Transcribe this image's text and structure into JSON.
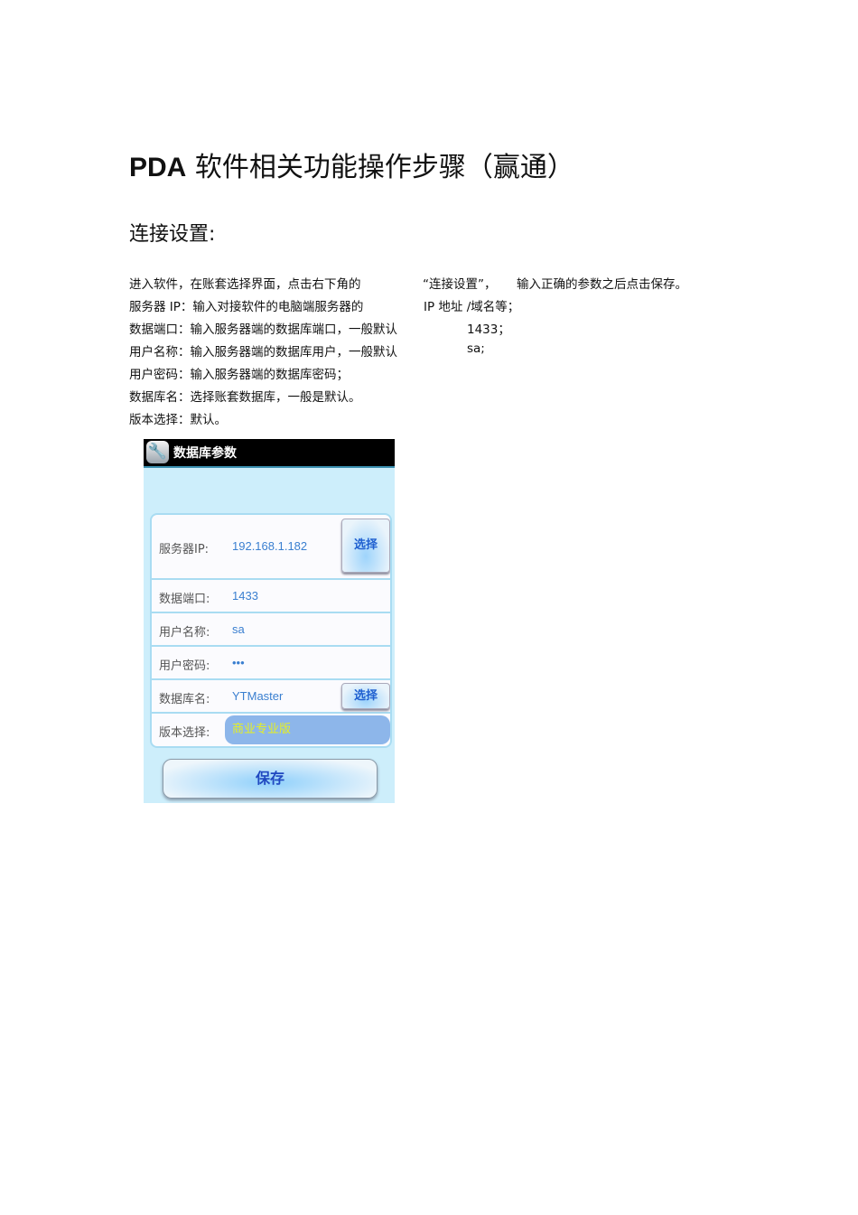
{
  "title_prefix": "PDA",
  "title_rest": "软件相关功能操作步骤（赢通）",
  "heading": "连接设置:",
  "lines": [
    [
      "进入软件，在账套选择界面，点击右下角的",
      "“连接设置”，",
      "输入正确的参数之后点击保存。"
    ],
    [
      "服务器  IP：输入对接软件的电脑端服务器的",
      "IP 地址 /域名等；"
    ],
    [
      "数据端口：输入服务器端的数据库端口，一般默认",
      "1433；"
    ],
    [
      "用户名称：输入服务器端的数据库用户，一般默认",
      "sa;"
    ],
    [
      "用户密码：输入服务器端的数据库密码；"
    ],
    [
      "数据库名：选择账套数据库，一般是默认。"
    ],
    [
      "版本选择：默认。"
    ]
  ],
  "phone": {
    "header": "数据库参数",
    "fields": [
      {
        "label": "服务器IP:",
        "value": "192.168.1.182",
        "button": "选择"
      },
      {
        "label": "数据端口:",
        "value": "1433"
      },
      {
        "label": "用户名称:",
        "value": "sa"
      },
      {
        "label": "用户密码:",
        "value": "•••"
      },
      {
        "label": "数据库名:",
        "value": "YTMaster",
        "button": "选择"
      },
      {
        "label": "版本选择:",
        "value": "商业专业版"
      }
    ],
    "save": "保存"
  }
}
